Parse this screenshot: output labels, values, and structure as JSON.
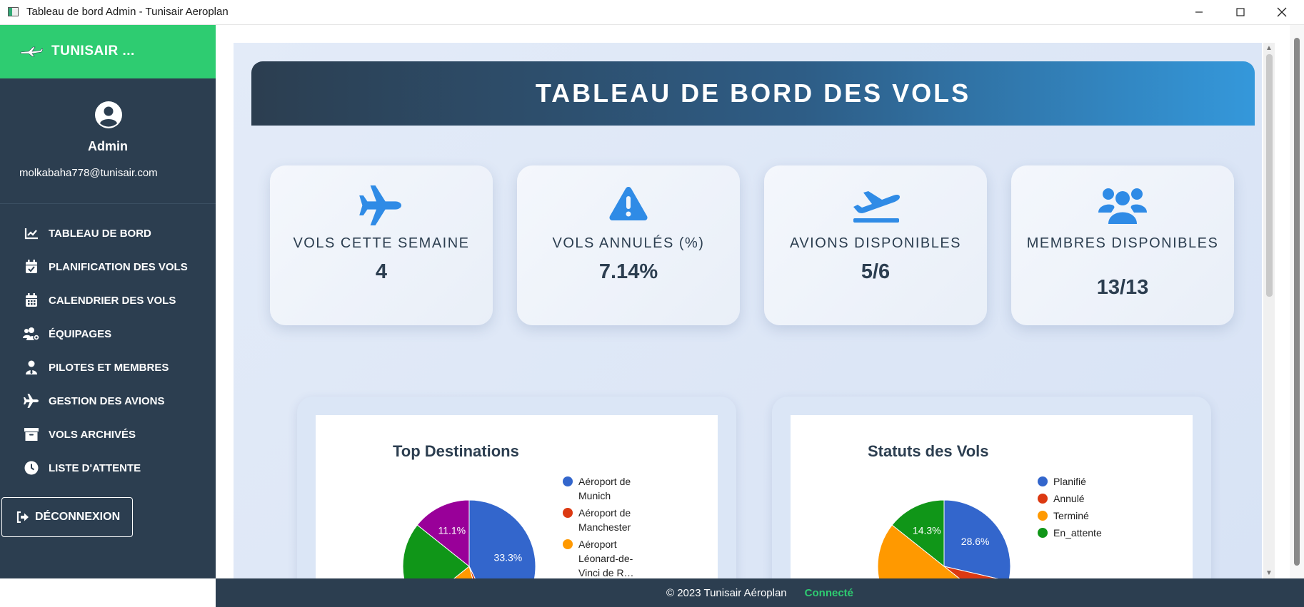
{
  "window": {
    "title": "Tableau de bord Admin - Tunisair Aeroplan",
    "controls": {
      "minimize": "minimize-icon",
      "maximize": "maximize-icon",
      "close": "close-icon"
    }
  },
  "sidebar": {
    "brand": "TUNISAIR ...",
    "user": {
      "name": "Admin",
      "email": "molkabaha778@tunisair.com"
    },
    "items": [
      {
        "label": "TABLEAU DE BORD",
        "icon": "chart-line-icon"
      },
      {
        "label": "PLANIFICATION DES VOLS",
        "icon": "calendar-check-icon"
      },
      {
        "label": "CALENDRIER DES VOLS",
        "icon": "calendar-icon"
      },
      {
        "label": "ÉQUIPAGES",
        "icon": "users-cog-icon"
      },
      {
        "label": "PILOTES ET MEMBRES",
        "icon": "user-tie-icon"
      },
      {
        "label": "GESTION DES AVIONS",
        "icon": "plane-icon"
      },
      {
        "label": "VOLS ARCHIVÉS",
        "icon": "archive-icon"
      },
      {
        "label": "LISTE D'ATTENTE",
        "icon": "clock-icon"
      }
    ],
    "logout": "DÉCONNEXION"
  },
  "header": {
    "title": "TABLEAU DE BORD DES VOLS"
  },
  "stats": [
    {
      "label": "VOLS CETTE SEMAINE",
      "value": "4",
      "icon": "plane-icon"
    },
    {
      "label": "VOLS ANNULÉS (%)",
      "value": "7.14%",
      "icon": "warning-icon"
    },
    {
      "label": "AVIONS DISPONIBLES",
      "value": "5/6",
      "icon": "plane-departure-icon"
    },
    {
      "label": "MEMBRES DISPONIBLES",
      "value": "13/13",
      "icon": "users-icon"
    }
  ],
  "colors": {
    "sidebar": "#2c3e50",
    "brand": "#2ecc71",
    "accent": "#2f8be6",
    "connected": "#2ecc71"
  },
  "chart_data": [
    {
      "type": "pie",
      "title": "Top Destinations",
      "legend_placement": "right",
      "categories": [
        "Aéroport de Munich",
        "Aéroport de Manchester",
        "Aéroport Léonard-de-Vinci de R…"
      ],
      "legend_labels": [
        "Aéroport de\nMunich",
        "Aéroport de\nManchester",
        "Aéroport\nLéonard-de-\nVinci de R…"
      ],
      "slices": [
        {
          "color": "#3366cc",
          "value": 33.3,
          "label": "33.3%"
        },
        {
          "color": "#dc3912",
          "value": 2.2,
          "label": ""
        },
        {
          "color": "#ff9900",
          "value": 14.4,
          "label": ""
        },
        {
          "color": "#109618",
          "value": 16.7,
          "label": ""
        },
        {
          "color": "#990099",
          "value": 11.1,
          "label": "11.1%"
        }
      ]
    },
    {
      "type": "pie",
      "title": "Statuts des Vols",
      "legend_placement": "right",
      "categories": [
        "Planifié",
        "Annulé",
        "Terminé",
        "En_attente"
      ],
      "legend_labels": [
        "Planifié",
        "Annulé",
        "Terminé",
        "En_attente"
      ],
      "slices": [
        {
          "color": "#3366cc",
          "value": 28.6,
          "label": "28.6%"
        },
        {
          "color": "#dc3912",
          "value": 7.1,
          "label": ""
        },
        {
          "color": "#ff9900",
          "value": 50.0,
          "label": ""
        },
        {
          "color": "#109618",
          "value": 14.3,
          "label": "14.3%"
        }
      ]
    }
  ],
  "footer": {
    "copyright": "© 2023 Tunisair Aéroplan",
    "status": "Connecté"
  }
}
